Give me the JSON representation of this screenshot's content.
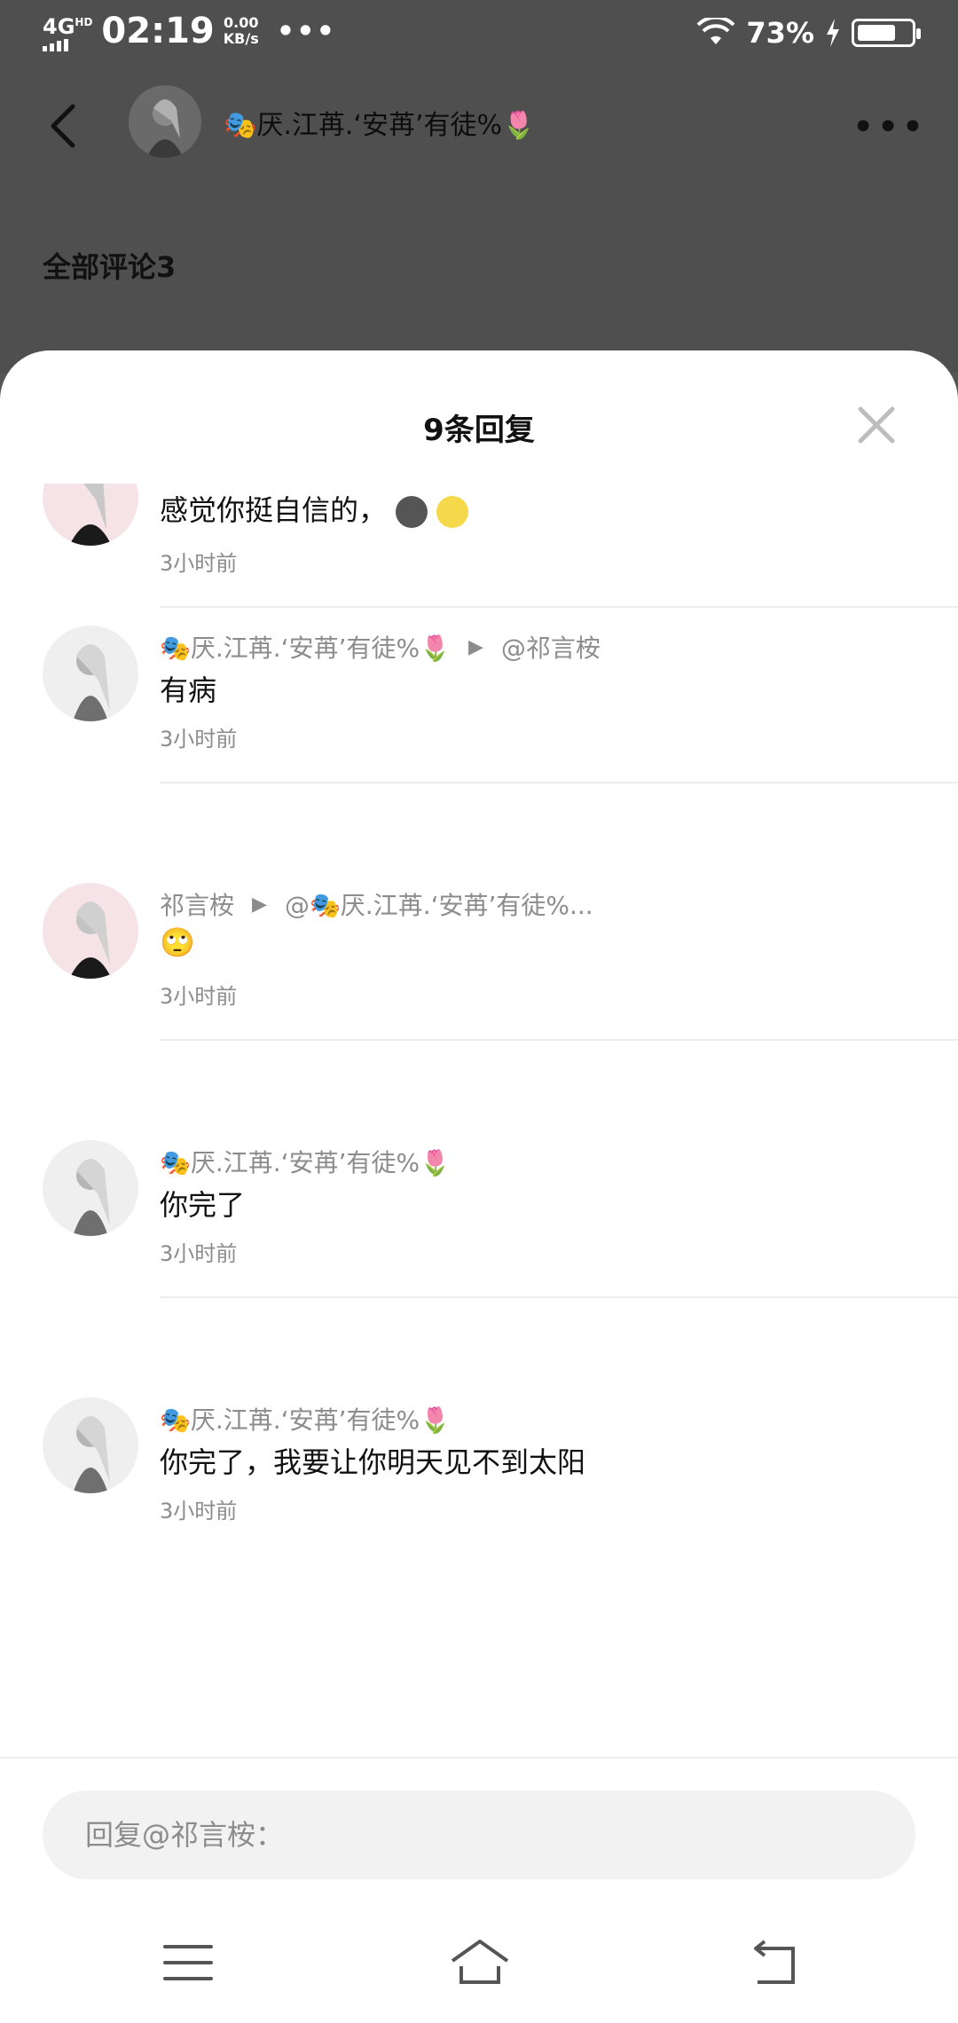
{
  "status_bar": {
    "network": "4G",
    "network_sup": "HD",
    "time": "02:19",
    "speed_value": "0.00",
    "speed_unit": "KB/s",
    "dots": "•••",
    "battery_percent": "73%",
    "battery_level": 0.73
  },
  "header": {
    "user_name": "🎭厌.江苒.‘安苒’有徒%🌷",
    "more": "•••",
    "section_title": "全部评论3"
  },
  "sheet": {
    "title": "9条回复"
  },
  "replies": [
    {
      "text": "感觉你挺自信的，",
      "emojis": [
        "dark-face",
        "smile-face"
      ],
      "time": "3小时前"
    },
    {
      "author": "🎭厌.江苒.‘安苒’有徒%🌷",
      "reply_to": "@祁言桉",
      "text": "有病",
      "time": "3小时前"
    },
    {
      "author": "祁言桉",
      "reply_to": "@🎭厌.江苒.‘安苒’有徒%...",
      "text": "🙄",
      "time": "3小时前"
    },
    {
      "author": "🎭厌.江苒.‘安苒’有徒%🌷",
      "text": "你完了",
      "time": "3小时前"
    },
    {
      "author": "🎭厌.江苒.‘安苒’有徒%🌷",
      "text": "你完了，我要让你明天见不到太阳",
      "time": "3小时前"
    }
  ],
  "reply_box": {
    "placeholder": "回复@祁言桉："
  },
  "nav": {
    "menu_icon": "menu-icon",
    "home_icon": "home-icon",
    "back_icon": "back-icon"
  }
}
